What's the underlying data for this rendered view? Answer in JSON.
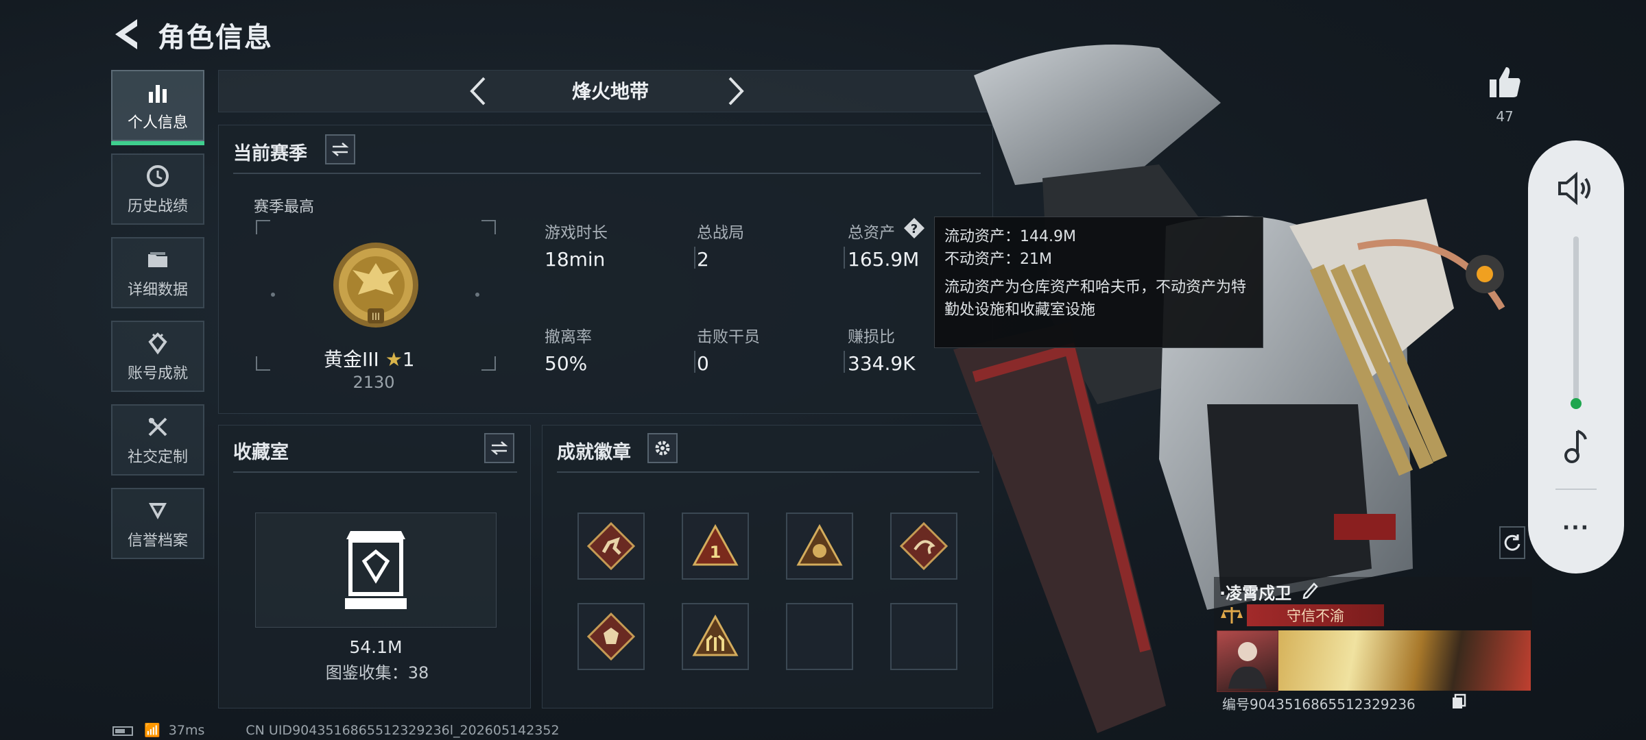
{
  "header": {
    "title": "角色信息"
  },
  "nav": [
    {
      "label": "个人信息",
      "icon": "bar-chart-icon",
      "active": true
    },
    {
      "label": "历史战绩",
      "icon": "clock-icon"
    },
    {
      "label": "详细数据",
      "icon": "folder-icon"
    },
    {
      "label": "账号成就",
      "icon": "achievement-icon"
    },
    {
      "label": "社交定制",
      "icon": "tools-icon"
    },
    {
      "label": "信誉档案",
      "icon": "shield-icon"
    }
  ],
  "mode_selector": {
    "label": "烽火地带"
  },
  "season": {
    "title": "当前赛季",
    "best_label": "赛季最高",
    "rank_name": "黄金III",
    "rank_stars": "1",
    "rank_points": "2130",
    "stats": {
      "play_time": {
        "label": "游戏时长",
        "value": "18min"
      },
      "total_matches": {
        "label": "总战局",
        "value": "2"
      },
      "total_assets": {
        "label": "总资产",
        "value": "165.9M"
      },
      "extract_rate": {
        "label": "撤离率",
        "value": "50%"
      },
      "kills": {
        "label": "击败干员",
        "value": "0"
      },
      "profit_ratio": {
        "label": "赚损比",
        "value": "334.9K"
      }
    }
  },
  "tooltip": {
    "liquid": "流动资产：144.9M",
    "fixed": "不动资产：21M",
    "desc": "流动资产为仓库资产和哈夫币，不动资产为特勤处设施和收藏室设施"
  },
  "collection": {
    "title": "收藏室",
    "value": "54.1M",
    "count_text": "图鉴收集：38"
  },
  "badges": {
    "title": "成就徽章"
  },
  "profile": {
    "name": "·凌霄戍卫",
    "title_badge": "守信不渝",
    "id_text": "编号9043516865512329236"
  },
  "like": {
    "count": "47"
  },
  "status": {
    "ping": "37ms",
    "uid": "CN UID9043516865512329236l_202605142352"
  },
  "colors": {
    "accent": "#3fcf8e",
    "gold": "#c8a24a",
    "rank_red": "#a22a2a"
  }
}
